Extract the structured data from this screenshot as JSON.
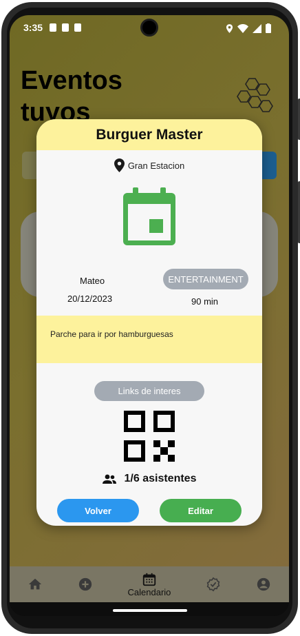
{
  "status_bar": {
    "time": "3:35"
  },
  "background": {
    "title_line1": "Eventos",
    "title_line2": "tuyos"
  },
  "bottom_nav": {
    "items": [
      {
        "icon": "home-icon",
        "label": ""
      },
      {
        "icon": "add-circle-icon",
        "label": ""
      },
      {
        "icon": "calendar-icon",
        "label": "Calendario"
      },
      {
        "icon": "verified-icon",
        "label": ""
      },
      {
        "icon": "account-icon",
        "label": ""
      }
    ]
  },
  "modal": {
    "title": "Burguer Master",
    "location": "Gran Estacion",
    "organizer": "Mateo",
    "date": "20/12/2023",
    "category": "ENTERTAINMENT",
    "duration": "90 min",
    "description": "Parche para ir por hamburguesas",
    "links_label": "Links de interes",
    "attendees": "1/6 asistentes",
    "back_label": "Volver",
    "edit_label": "Editar"
  },
  "colors": {
    "header_yellow": "#fdf29c",
    "calendar_green": "#4caf50",
    "back_blue": "#2b97ef",
    "edit_green": "#47ae50",
    "chip_gray": "#a3aab3"
  }
}
